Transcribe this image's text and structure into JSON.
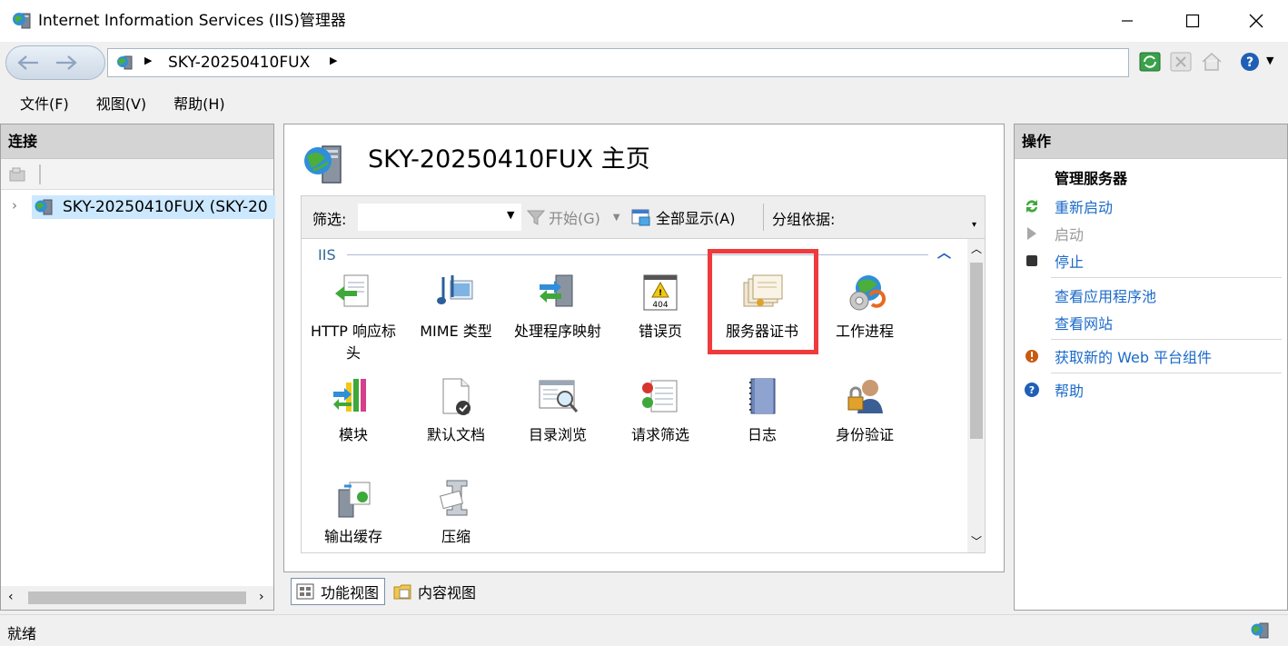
{
  "window": {
    "title": "Internet Information Services (IIS)管理器",
    "minimize_icon": "minimize-icon",
    "maximize_icon": "maximize-icon",
    "close_icon": "close-icon"
  },
  "address": {
    "server": "SKY-20250410FUX"
  },
  "menu": [
    "文件(F)",
    "视图(V)",
    "帮助(H)"
  ],
  "connections": {
    "title": "连接",
    "tree_item": "SKY-20250410FUX (SKY-20"
  },
  "main": {
    "title": "SKY-20250410FUX 主页",
    "filter_label": "筛选:",
    "filter_value": "",
    "start_label": "开始(G)",
    "showall_label": "全部显示(A)",
    "groupby_label": "分组依据:",
    "group_title": "IIS",
    "features": [
      {
        "label": "HTTP 响应标头",
        "icon": "http-headers-icon"
      },
      {
        "label": "MIME 类型",
        "icon": "mime-types-icon"
      },
      {
        "label": "处理程序映射",
        "icon": "handler-mappings-icon"
      },
      {
        "label": "错误页",
        "icon": "error-pages-icon"
      },
      {
        "label": "服务器证书",
        "icon": "server-certificates-icon"
      },
      {
        "label": "工作进程",
        "icon": "worker-processes-icon"
      },
      {
        "label": "模块",
        "icon": "modules-icon"
      },
      {
        "label": "默认文档",
        "icon": "default-document-icon"
      },
      {
        "label": "目录浏览",
        "icon": "directory-browsing-icon"
      },
      {
        "label": "请求筛选",
        "icon": "request-filtering-icon"
      },
      {
        "label": "日志",
        "icon": "logging-icon"
      },
      {
        "label": "身份验证",
        "icon": "authentication-icon"
      },
      {
        "label": "输出缓存",
        "icon": "output-caching-icon"
      },
      {
        "label": "压缩",
        "icon": "compression-icon"
      }
    ],
    "error_badge": "404"
  },
  "viewtabs": [
    "功能视图",
    "内容视图"
  ],
  "actions": {
    "title": "操作",
    "heading": "管理服务器",
    "items": [
      {
        "label": "重新启动",
        "icon": "restart-icon",
        "enabled": true
      },
      {
        "label": "启动",
        "icon": "start-icon",
        "enabled": false
      },
      {
        "label": "停止",
        "icon": "stop-icon",
        "enabled": true
      },
      {
        "label": "查看应用程序池",
        "icon": "",
        "enabled": true
      },
      {
        "label": "查看网站",
        "icon": "",
        "enabled": true
      },
      {
        "label": "获取新的 Web 平台组件",
        "icon": "web-platform-icon",
        "enabled": true
      },
      {
        "label": "帮助",
        "icon": "help-icon",
        "enabled": true
      }
    ]
  },
  "status": {
    "text": "就绪"
  },
  "colors": {
    "highlight": "#ef3b3b",
    "link": "#1b6ac9",
    "selection": "#cce8ff"
  }
}
